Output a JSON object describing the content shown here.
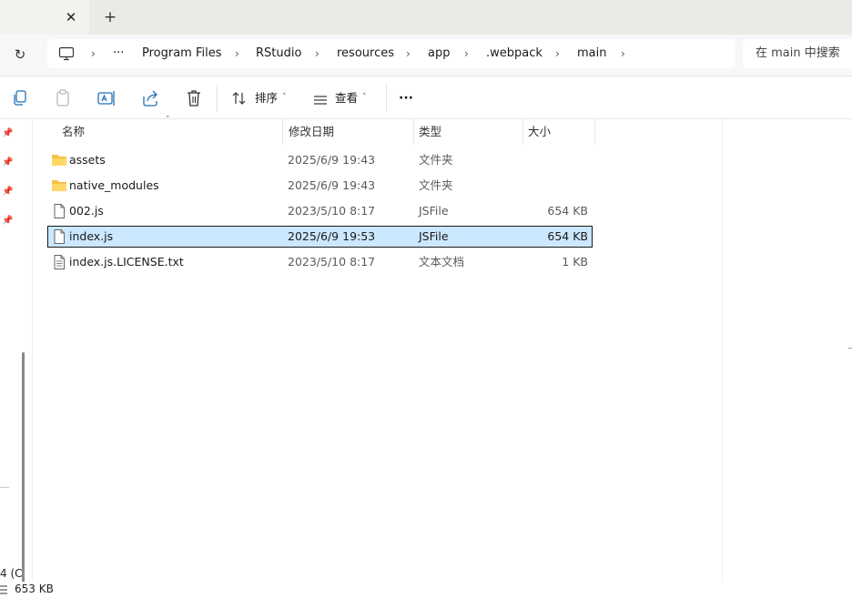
{
  "tabs": {
    "close_glyph": "✕",
    "new_tab_glyph": "+"
  },
  "address": {
    "refresh_glyph": "↻",
    "overflow_glyph": "···",
    "separator_glyph": "›",
    "crumbs": [
      "Program Files",
      "RStudio",
      "resources",
      "app",
      ".webpack",
      "main"
    ],
    "search_placeholder": "在 main 中搜索"
  },
  "toolbar": {
    "sort_label": "排序",
    "view_label": "查看",
    "more_glyph": "···",
    "icons": [
      "copy-icon",
      "paste-icon",
      "rename-icon",
      "share-icon",
      "delete-icon"
    ]
  },
  "columns": {
    "name": "名称",
    "modified": "修改日期",
    "type": "类型",
    "size": "大小",
    "sort_glyph": "˄"
  },
  "files": [
    {
      "name": "assets",
      "modified": "2025/6/9 19:43",
      "type": "文件夹",
      "size": "",
      "kind": "folder",
      "selected": false
    },
    {
      "name": "native_modules",
      "modified": "2025/6/9 19:43",
      "type": "文件夹",
      "size": "",
      "kind": "folder",
      "selected": false
    },
    {
      "name": "002.js",
      "modified": "2023/5/10 8:17",
      "type": "JSFile",
      "size": "654 KB",
      "kind": "file",
      "selected": false
    },
    {
      "name": "index.js",
      "modified": "2025/6/9 19:53",
      "type": "JSFile",
      "size": "654 KB",
      "kind": "file",
      "selected": true
    },
    {
      "name": "index.js.LICENSE.txt",
      "modified": "2023/5/10 8:17",
      "type": "文本文档",
      "size": "1 KB",
      "kind": "text",
      "selected": false
    }
  ],
  "nav": {
    "fragment_text": "4 (C"
  },
  "status": {
    "selected_size": "653 KB"
  },
  "colors": {
    "selection_bg": "#cce8ff",
    "folder_yellow": "#f5c242",
    "accent_blue": "#1f6fb5"
  }
}
